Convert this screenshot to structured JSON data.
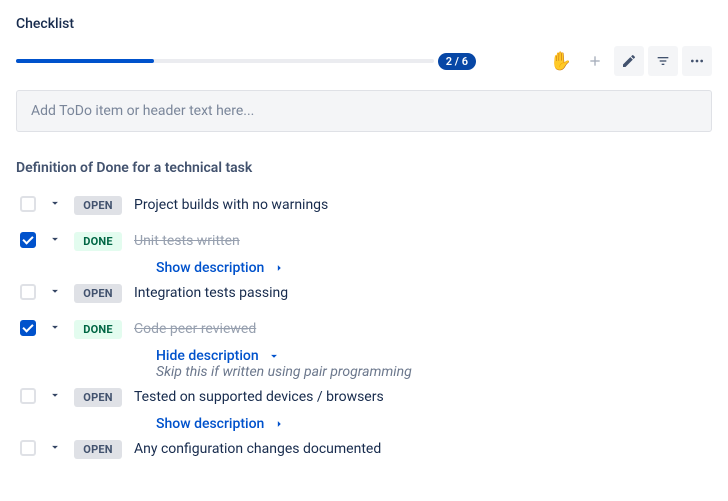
{
  "title": "Checklist",
  "progress": {
    "done": 2,
    "total": 6,
    "percent": 33
  },
  "input_placeholder": "Add ToDo item or header text here...",
  "toolbar": {
    "hand_icon": "✋",
    "plus_label": "Add",
    "edit_label": "Edit",
    "filter_label": "Filter",
    "more_label": "More"
  },
  "section_header": "Definition of Done for a technical task",
  "status_labels": {
    "open": "OPEN",
    "done": "DONE"
  },
  "desc_labels": {
    "show": "Show description",
    "hide": "Hide description"
  },
  "items": [
    {
      "label": "Project builds with no warnings",
      "status": "open",
      "checked": false
    },
    {
      "label": "Unit tests written",
      "status": "done",
      "checked": true,
      "show_toggle": "show"
    },
    {
      "label": "Integration tests passing",
      "status": "open",
      "checked": false
    },
    {
      "label": "Code peer reviewed",
      "status": "done",
      "checked": true,
      "show_toggle": "hide",
      "description": "Skip this if written using pair programming"
    },
    {
      "label": "Tested on supported devices / browsers",
      "status": "open",
      "checked": false,
      "show_toggle": "show"
    },
    {
      "label": "Any configuration changes documented",
      "status": "open",
      "checked": false
    }
  ]
}
